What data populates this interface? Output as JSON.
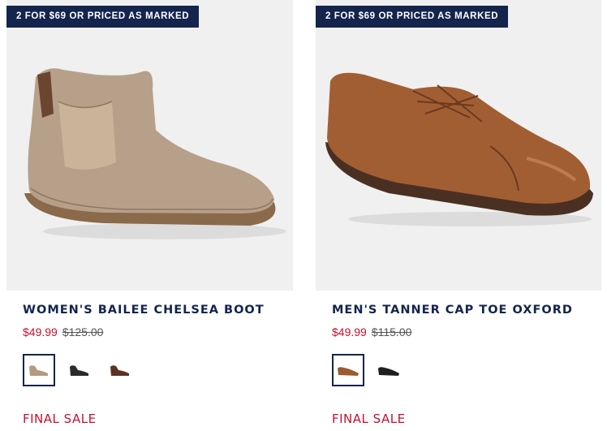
{
  "products": [
    {
      "badge": "2 FOR $69 OR PRICED AS MARKED",
      "title": "WOMEN'S BAILEE CHELSEA BOOT",
      "sale_price": "$49.99",
      "original_price": "$125.00",
      "final_sale": "FINAL SALE",
      "image_icon": "tan-chelsea-boot",
      "swatches": [
        {
          "color": "#b39a80",
          "selected": true
        },
        {
          "color": "#2a2a2a",
          "selected": false
        },
        {
          "color": "#5a3324",
          "selected": false
        }
      ]
    },
    {
      "badge": "2 FOR $69 OR PRICED AS MARKED",
      "title": "MEN'S TANNER CAP TOE OXFORD",
      "sale_price": "$49.99",
      "original_price": "$115.00",
      "final_sale": "FINAL SALE",
      "image_icon": "brown-cap-toe-oxford",
      "swatches": [
        {
          "color": "#9c5a30",
          "selected": true
        },
        {
          "color": "#1e1e1e",
          "selected": false
        }
      ]
    }
  ]
}
